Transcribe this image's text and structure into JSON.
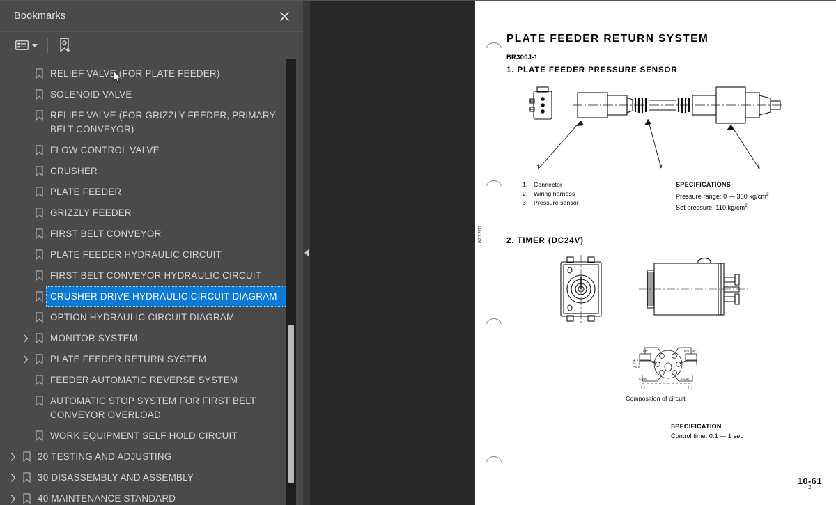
{
  "panel": {
    "title": "Bookmarks",
    "close_icon": "close-icon",
    "toolbar": {
      "options_icon": "list-options-icon",
      "new_bookmark_icon": "new-bookmark-icon"
    },
    "items": [
      {
        "label": "RELIEF VALVE (FOR PLATE FEEDER)",
        "level": 1,
        "expandable": false,
        "selected": false
      },
      {
        "label": "SOLENOID VALVE",
        "level": 1,
        "expandable": false,
        "selected": false
      },
      {
        "label": "RELIEF VALVE (FOR GRIZZLY FEEDER, PRIMARY BELT CONVEYOR)",
        "level": 1,
        "expandable": false,
        "selected": false
      },
      {
        "label": "FLOW CONTROL VALVE",
        "level": 1,
        "expandable": false,
        "selected": false
      },
      {
        "label": "CRUSHER",
        "level": 1,
        "expandable": false,
        "selected": false
      },
      {
        "label": "PLATE FEEDER",
        "level": 1,
        "expandable": false,
        "selected": false
      },
      {
        "label": "GRIZZLY FEEDER",
        "level": 1,
        "expandable": false,
        "selected": false
      },
      {
        "label": "FIRST BELT CONVEYOR",
        "level": 1,
        "expandable": false,
        "selected": false
      },
      {
        "label": "PLATE FEEDER HYDRAULIC CIRCUIT",
        "level": 1,
        "expandable": false,
        "selected": false
      },
      {
        "label": "FIRST BELT CONVEYOR HYDRAULIC CIRCUIT",
        "level": 1,
        "expandable": false,
        "selected": false
      },
      {
        "label": "CRUSHER DRIVE HYDRAULIC CIRCUIT DIAGRAM",
        "level": 1,
        "expandable": false,
        "selected": true
      },
      {
        "label": "OPTION HYDRAULIC CIRCUIT DIAGRAM",
        "level": 1,
        "expandable": false,
        "selected": false
      },
      {
        "label": "MONITOR SYSTEM",
        "level": 1,
        "expandable": true,
        "selected": false
      },
      {
        "label": "PLATE FEEDER RETURN SYSTEM",
        "level": 1,
        "expandable": true,
        "selected": false
      },
      {
        "label": "FEEDER AUTOMATIC REVERSE SYSTEM",
        "level": 1,
        "expandable": false,
        "selected": false
      },
      {
        "label": "AUTOMATIC STOP SYSTEM FOR FIRST BELT CONVEYOR OVERLOAD",
        "level": 1,
        "expandable": false,
        "selected": false
      },
      {
        "label": "WORK EQUIPMENT SELF HOLD CIRCUIT",
        "level": 1,
        "expandable": false,
        "selected": false
      },
      {
        "label": "20 TESTING AND ADJUSTING",
        "level": 0,
        "expandable": true,
        "selected": false
      },
      {
        "label": "30 DISASSEMBLY AND ASSEMBLY",
        "level": 0,
        "expandable": true,
        "selected": false
      },
      {
        "label": "40 MAINTENANCE STANDARD",
        "level": 0,
        "expandable": true,
        "selected": false
      }
    ],
    "scrollbar": {
      "thumb_top_pct": 59.5,
      "thumb_height_pct": 35.5
    },
    "collapse_handle_icon": "collapse-left-icon"
  },
  "document": {
    "heading": "PLATE FEEDER RETURN SYSTEM",
    "model": "BR300J-1",
    "section1_title": "1. PLATE FEEDER PRESSURE SENSOR",
    "section2_title": "2. TIMER (DC24V)",
    "side_code": "823201",
    "legend": [
      {
        "num": "1.",
        "text": "Connector"
      },
      {
        "num": "2.",
        "text": "Wiring harness"
      },
      {
        "num": "3.",
        "text": "Pressure sensor"
      }
    ],
    "spec1": {
      "title": "SPECIFICATIONS",
      "line1": "Pressure range: 0 — 350 kg/cm",
      "line1_sup": "2",
      "line2": "Set pressure: 110 kg/cm",
      "line2_sup": "2"
    },
    "spec2": {
      "title": "SPECIFICATION",
      "line1": "Control time: 0.1 — 1 sec"
    },
    "circuit_caption": "Composition of circuit",
    "circuit_labels": {
      "nc": "NC",
      "no": "NO",
      "com": "COM",
      "minus": "(−)",
      "plus": "(+)"
    },
    "callouts": [
      "1",
      "2",
      "3"
    ],
    "page_number": "10-61",
    "page_number_sub": "2"
  },
  "colors": {
    "panel_bg": "#4a4a4a",
    "viewer_bg": "#282828",
    "selection": "#0a7ad4",
    "text": "#d4d4d4",
    "scroll_track": "#1e1e1e",
    "scroll_thumb": "#b9b9b9"
  }
}
